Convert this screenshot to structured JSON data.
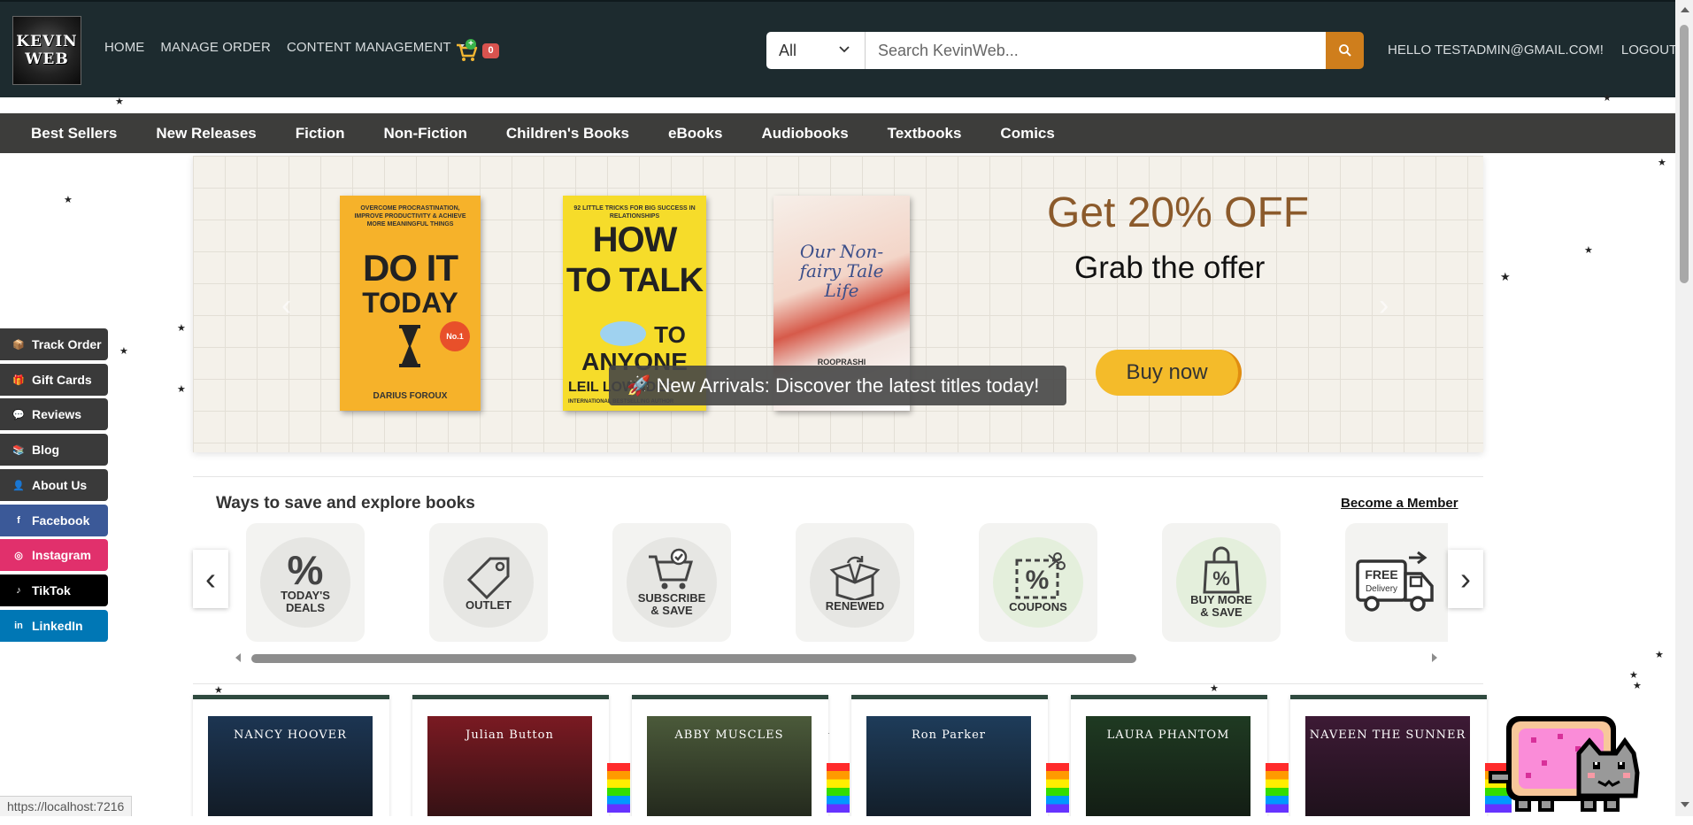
{
  "header": {
    "logo_line1": "KEVIN",
    "logo_line2": "WEB",
    "nav": [
      "HOME",
      "MANAGE ORDER",
      "CONTENT MANAGEMENT"
    ],
    "cart_count": "0",
    "search": {
      "category": "All",
      "placeholder": "Search KevinWeb..."
    },
    "greeting": "HELLO TESTADMIN@GMAIL.COM!",
    "logout": "LOGOUT"
  },
  "categories": [
    "Best Sellers",
    "New Releases",
    "Fiction",
    "Non-Fiction",
    "Children's Books",
    "eBooks",
    "Audiobooks",
    "Textbooks",
    "Comics"
  ],
  "banner": {
    "book1": {
      "top": "OVERCOME PROCRASTINATION, IMPROVE PRODUCTIVITY & ACHIEVE MORE MEANINGFUL THINGS",
      "title1": "DO IT",
      "title2": "TODAY",
      "badge": "No.1",
      "author": "DARIUS FOROUX"
    },
    "book2": {
      "top": "92 LITTLE TRICKS FOR BIG SUCCESS IN RELATIONSHIPS",
      "title1": "HOW",
      "title2": "TO TALK",
      "title3": "TO",
      "title4": "ANYONE",
      "author": "LEIL LOWNDES",
      "tagline": "INTERNATIONAL BESTSELLING AUTHOR"
    },
    "book3": {
      "title": "Our Non-fairy Tale Life",
      "author": "ROOPRASHI"
    },
    "headline": "Get 20% OFF",
    "subline": "Grab the offer",
    "cta": "Buy now",
    "toast": "🚀 New Arrivals: Discover the latest titles today!"
  },
  "side_buttons": [
    {
      "label": "Track Order",
      "icon": "📦",
      "color": "#3a3a3a"
    },
    {
      "label": "Gift Cards",
      "icon": "🎁",
      "color": "#3a3a3a"
    },
    {
      "label": "Reviews",
      "icon": "💬",
      "color": "#3a3a3a"
    },
    {
      "label": "Blog",
      "icon": "📚",
      "color": "#3a3a3a"
    },
    {
      "label": "About Us",
      "icon": "👤",
      "color": "#3a3a3a"
    },
    {
      "label": "Facebook",
      "icon": "f",
      "color": "#3b5998"
    },
    {
      "label": "Instagram",
      "icon": "◎",
      "color": "#e1306c"
    },
    {
      "label": "TikTok",
      "icon": "♪",
      "color": "#000000"
    },
    {
      "label": "LinkedIn",
      "icon": "in",
      "color": "#0077b5"
    }
  ],
  "ways": {
    "title": "Ways to save and explore books",
    "member_link": "Become a Member",
    "tiles": [
      {
        "line1": "TODAY'S",
        "line2": "DEALS",
        "icon": "%"
      },
      {
        "line1": "OUTLET",
        "line2": "",
        "icon": "tag"
      },
      {
        "line1": "SUBSCRIBE",
        "line2": "& SAVE",
        "icon": "cart"
      },
      {
        "line1": "RENEWED",
        "line2": "",
        "icon": "box"
      },
      {
        "line1": "COUPONS",
        "line2": "",
        "icon": "coupon"
      },
      {
        "line1": "BUY MORE",
        "line2": "& SAVE",
        "icon": "bag"
      },
      {
        "line1": "FREE",
        "line2": "Delivery",
        "icon": "truck"
      }
    ]
  },
  "books_row": [
    {
      "author": "NANCY HOOVER",
      "bg": "#1c3552"
    },
    {
      "author": "Julian Button",
      "bg": "#7a1a22"
    },
    {
      "author": "ABBY MUSCLES",
      "bg": "#4b5a3a"
    },
    {
      "author": "Ron Parker",
      "bg": "#1e3c5a"
    },
    {
      "author": "LAURA PHANTOM",
      "bg": "#1f3a22"
    },
    {
      "author": "NAVEEN THE SUNNER",
      "bg": "#3d1a35"
    }
  ],
  "status_url": "https://localhost:7216"
}
